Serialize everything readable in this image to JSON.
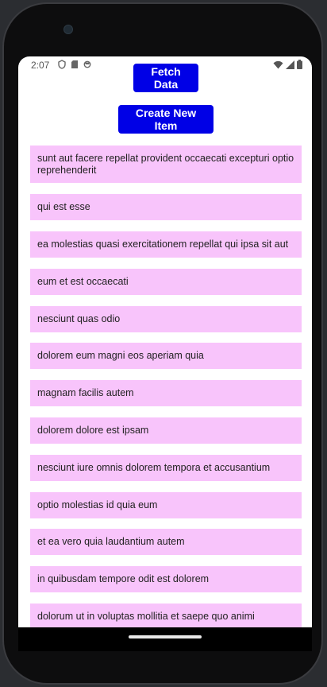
{
  "status_bar": {
    "time": "2:07"
  },
  "buttons": {
    "fetch_label": "Fetch Data",
    "create_label": "Create New Item"
  },
  "items": [
    "sunt aut facere repellat provident occaecati excepturi optio reprehenderit",
    "qui est esse",
    "ea molestias quasi exercitationem repellat qui ipsa sit aut",
    "eum et est occaecati",
    "nesciunt quas odio",
    "dolorem eum magni eos aperiam quia",
    "magnam facilis autem",
    "dolorem dolore est ipsam",
    "nesciunt iure omnis dolorem tempora et accusantium",
    "optio molestias id quia eum",
    "et ea vero quia laudantium autem",
    "in quibusdam tempore odit est dolorem",
    "dolorum ut in voluptas mollitia et saepe quo animi"
  ],
  "colors": {
    "button_bg": "#0000e6",
    "item_bg": "#f8c4fb"
  }
}
